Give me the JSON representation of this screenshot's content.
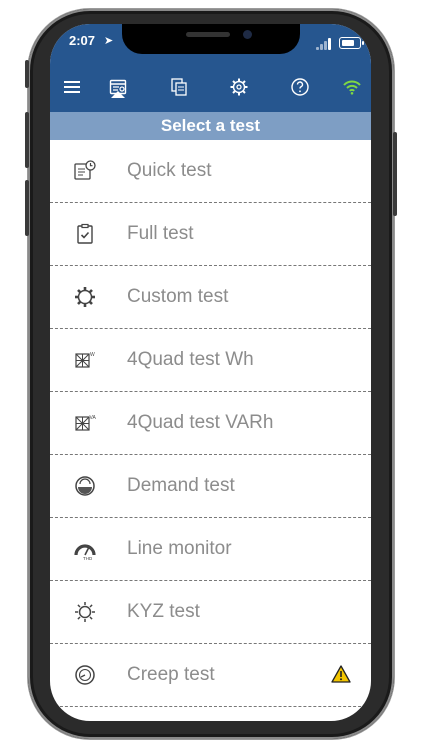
{
  "status": {
    "time": "2:07",
    "location_glyph": "➤"
  },
  "toolbar": {
    "icons": [
      "menu-icon",
      "test-card-icon",
      "copy-icon",
      "settings-icon",
      "help-icon",
      "wifi-icon"
    ],
    "active": "test-card-icon",
    "wifi_color": "#7fd843"
  },
  "title": "Select a test",
  "colors": {
    "header": "#26568f",
    "title_bar": "#7e9ec4",
    "label": "#8c8c8c",
    "warning": "#f2c500"
  },
  "tests": [
    {
      "label": "Quick test",
      "icon": "quick-test-icon"
    },
    {
      "label": "Full test",
      "icon": "clipboard-check-icon"
    },
    {
      "label": "Custom test",
      "icon": "gear-icon"
    },
    {
      "label": "4Quad test Wh",
      "icon": "quad-w-icon",
      "icon_sup": "W"
    },
    {
      "label": "4Quad test VARh",
      "icon": "quad-va-icon",
      "icon_sup": "VA"
    },
    {
      "label": "Demand test",
      "icon": "demand-icon"
    },
    {
      "label": "Line monitor",
      "icon": "gauge-icon",
      "icon_sub": "THD"
    },
    {
      "label": "KYZ test",
      "icon": "sun-icon"
    },
    {
      "label": "Creep test",
      "icon": "creep-icon",
      "warning": true
    }
  ]
}
